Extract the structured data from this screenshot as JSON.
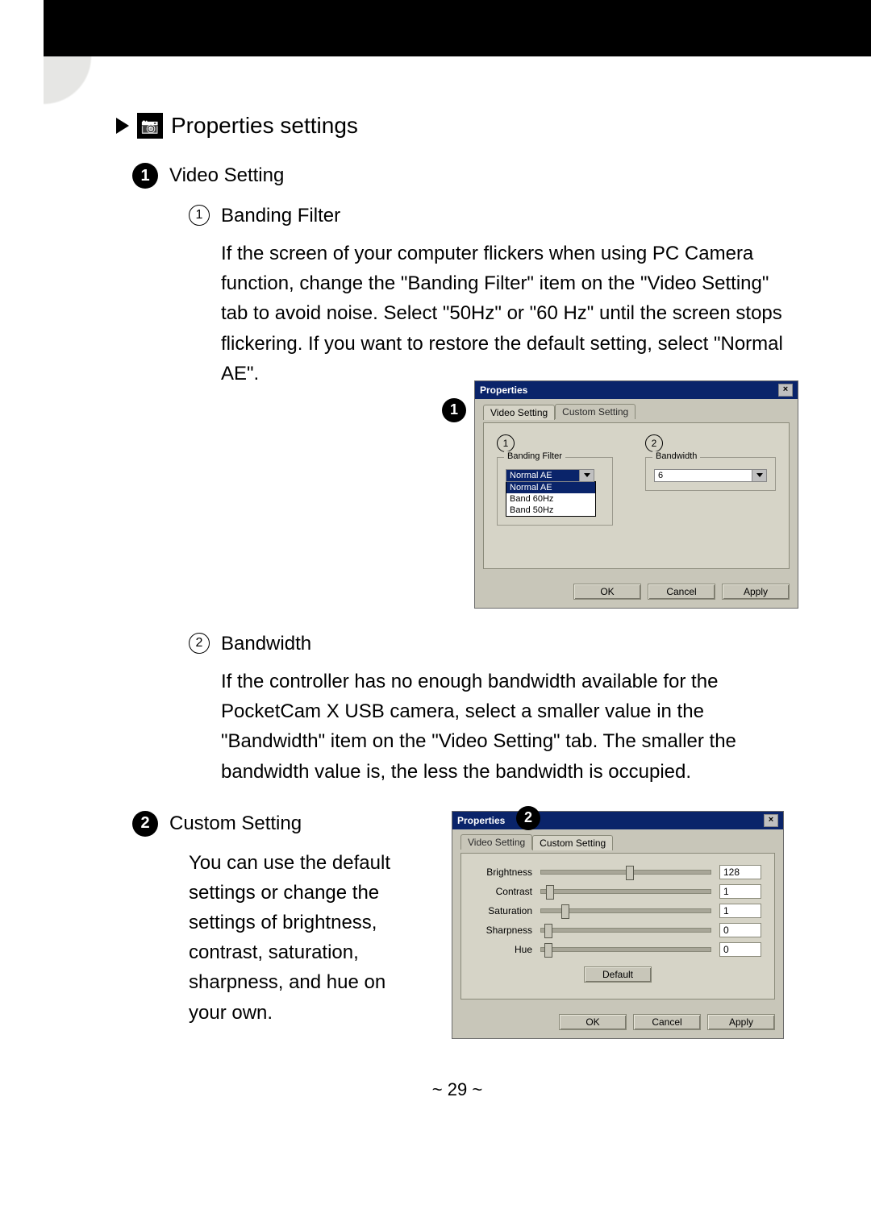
{
  "header": {
    "section_title": "Properties settings"
  },
  "sec1": {
    "num": "1",
    "title": "Video Setting",
    "sub1": {
      "num": "1",
      "title": "Banding Filter",
      "body": "If the screen of your computer flickers when using PC Camera function, change the \"Banding Filter\" item on the \"Video Setting\" tab to avoid noise. Select \"50Hz\" or \"60 Hz\" until the screen stops flickering. If you want to restore the default setting, select \"Normal AE\"."
    },
    "sub2": {
      "num": "2",
      "title": "Bandwidth",
      "body": "If the controller has no enough bandwidth available for the PocketCam X USB camera, select a smaller value in the \"Bandwidth\" item on the \"Video Setting\" tab. The smaller the bandwidth value is, the less the bandwidth is occupied."
    }
  },
  "dialog1": {
    "title": "Properties",
    "callout_num": "1",
    "tab_video": "Video Setting",
    "tab_custom": "Custom Setting",
    "group1_marker": "1",
    "group1_legend": "Banding Filter",
    "group1_selected": "Normal AE",
    "group1_options": [
      "Normal AE",
      "Band 60Hz",
      "Band 50Hz"
    ],
    "group2_marker": "2",
    "group2_legend": "Bandwidth",
    "group2_selected": "6",
    "btn_ok": "OK",
    "btn_cancel": "Cancel",
    "btn_apply": "Apply"
  },
  "sec2": {
    "num": "2",
    "title": "Custom Setting",
    "body": "You can use the default settings or change the settings of brightness, contrast, saturation, sharpness, and hue on your own."
  },
  "dialog2": {
    "title": "Properties",
    "callout_num": "2",
    "tab_video": "Video Setting",
    "tab_custom": "Custom Setting",
    "sliders": [
      {
        "label": "Brightness",
        "value": "128",
        "pos": 50
      },
      {
        "label": "Contrast",
        "value": "1",
        "pos": 3
      },
      {
        "label": "Saturation",
        "value": "1",
        "pos": 12
      },
      {
        "label": "Sharpness",
        "value": "0",
        "pos": 2
      },
      {
        "label": "Hue",
        "value": "0",
        "pos": 2
      }
    ],
    "btn_default": "Default",
    "btn_ok": "OK",
    "btn_cancel": "Cancel",
    "btn_apply": "Apply"
  },
  "footer": {
    "pager": "~  29  ~"
  }
}
